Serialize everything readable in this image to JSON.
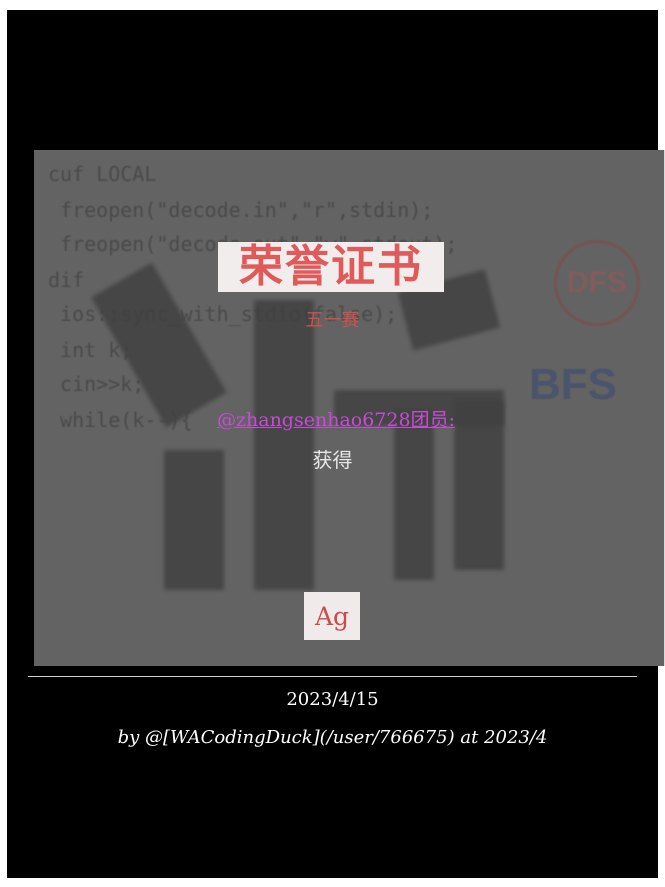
{
  "certificate": {
    "title": "荣誉证书",
    "subtitle": "五一赛",
    "member_link": "@zhangsenhao6728",
    "member_suffix": "团员:",
    "award_text": "获得",
    "badge": "Ag"
  },
  "background_code": [
    "cuf LOCAL",
    " freopen(\"decode.in\",\"r\",stdin);",
    " freopen(\"decode.out\",\"w\",stdout);",
    "dif",
    " ios::sync_with_stdio(false);",
    " int k;",
    " cin>>k;",
    " while(k--){"
  ],
  "footer": {
    "date": "2023/4/15",
    "byline": "by @[WACodingDuck](/user/766675) at 2023/4"
  },
  "colors": {
    "frame": "#000000",
    "title": "#e05a5a",
    "member_link": "#c64bd6"
  }
}
